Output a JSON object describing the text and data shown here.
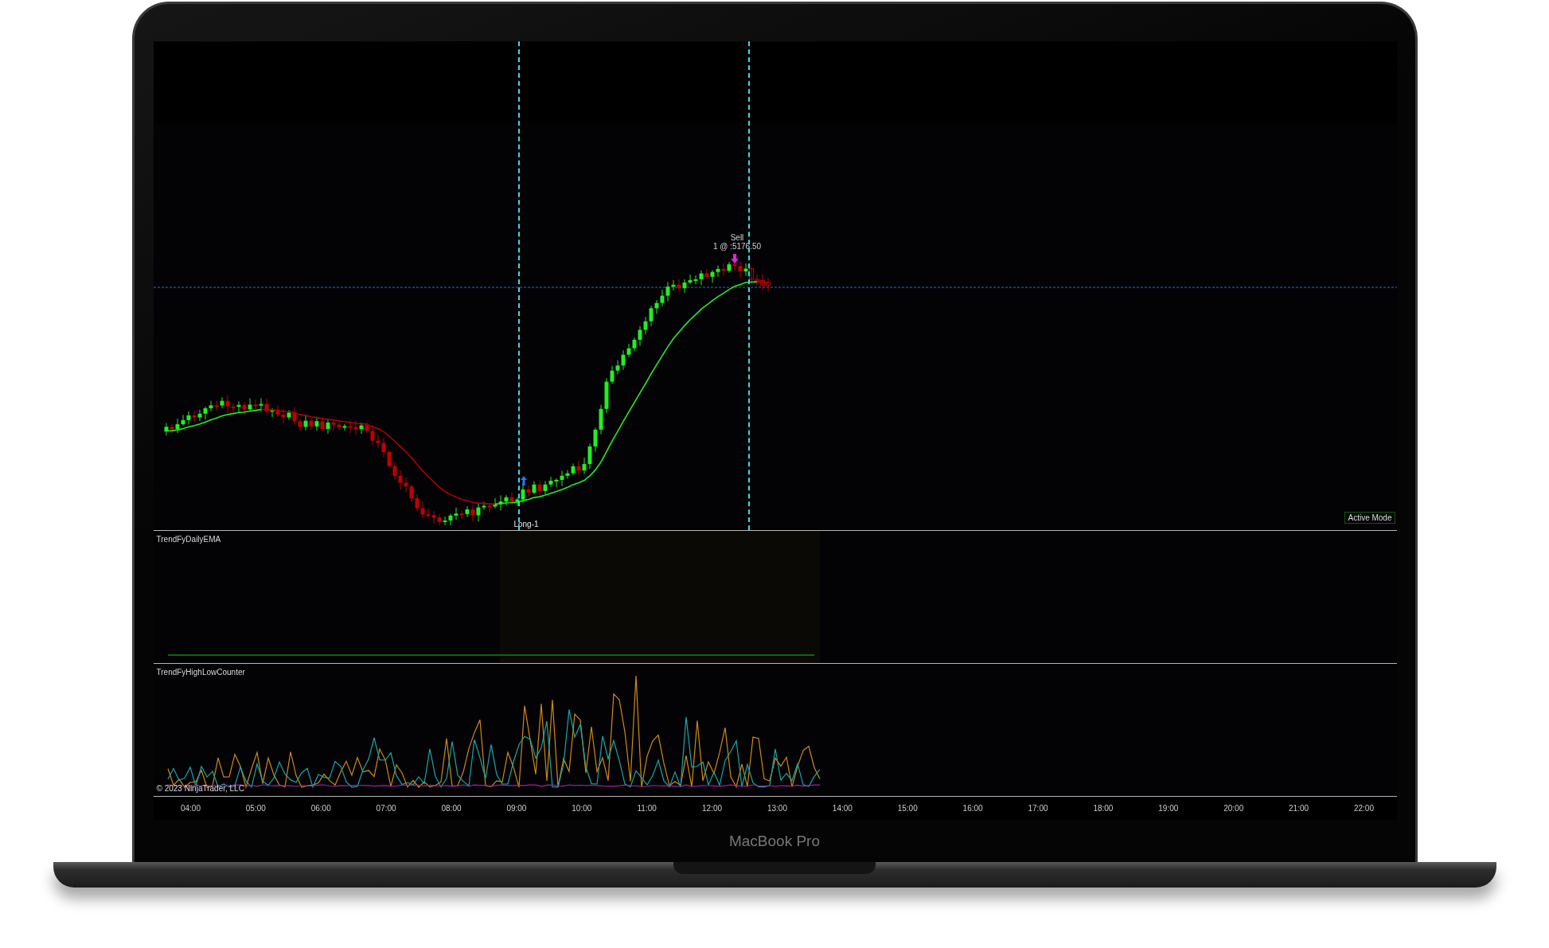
{
  "chart": {
    "trade_markers": [
      {
        "kind": "exit",
        "label": "Sell",
        "detail": "1 @ :5176.50"
      },
      {
        "kind": "entry",
        "label": "Long-1"
      }
    ],
    "mode_badge": "Active Mode",
    "panels": [
      {
        "title": "TrendFyDailyEMA"
      },
      {
        "title": "TrendFyHighLowCounter"
      }
    ],
    "copyright": "© 2023 NinjaTrader, LLC",
    "time_axis": [
      "04:00",
      "05:00",
      "06:00",
      "07:00",
      "08:00",
      "09:00",
      "10:00",
      "11:00",
      "12:00",
      "13:00",
      "14:00",
      "15:00",
      "16:00",
      "17:00",
      "18:00",
      "19:00",
      "20:00",
      "21:00",
      "22:00"
    ]
  },
  "device": {
    "label": "MacBook Pro"
  }
}
